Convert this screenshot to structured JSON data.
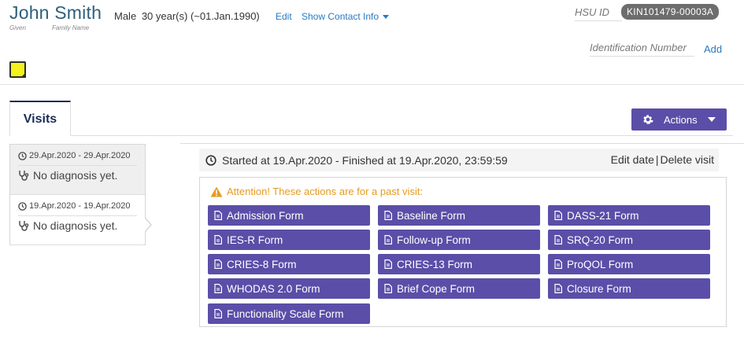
{
  "patient": {
    "full_name": "John Smith",
    "given_label": "Given",
    "family_label": "Family Name",
    "sex": "Male",
    "age": "30 year(s) (~01.Jan.1990)",
    "edit_label": "Edit",
    "contact_label": "Show Contact Info",
    "hsu_label": "HSU ID",
    "hsu_id": "KIN101479-00003A",
    "id_number_label": "Identification Number",
    "id_add_label": "Add"
  },
  "tabs": {
    "visits_label": "Visits"
  },
  "actions": {
    "label": "Actions"
  },
  "visits": [
    {
      "date": "29.Apr.2020 - 29.Apr.2020",
      "diagnosis": "No diagnosis yet."
    },
    {
      "date": "19.Apr.2020 - 19.Apr.2020",
      "diagnosis": "No diagnosis yet."
    }
  ],
  "visit_detail": {
    "summary": "Started at 19.Apr.2020 - Finished at 19.Apr.2020, 23:59:59",
    "edit_date_label": "Edit date",
    "separator": "|",
    "delete_label": "Delete visit",
    "attention": "Attention! These actions are for a past visit:"
  },
  "forms": [
    "Admission Form",
    "Baseline Form",
    "DASS-21 Form",
    "IES-R Form",
    "Follow-up Form",
    "SRQ-20 Form",
    "CRIES-8 Form",
    "CRIES-13 Form",
    "ProQOL Form",
    "WHODAS 2.0 Form",
    "Brief Cope Form",
    "Closure Form",
    "Functionality Scale Form"
  ],
  "colors": {
    "primary_button": "#5a4ea8",
    "link": "#2a7ac0",
    "warning": "#e69b22",
    "name": "#2f5f7a",
    "note": "#f3f21c"
  },
  "icons": {
    "note": "sticky-note-icon",
    "gear": "gear-icon",
    "clock": "clock-icon",
    "stethoscope": "stethoscope-icon",
    "warning": "warning-icon",
    "file": "file-icon"
  }
}
